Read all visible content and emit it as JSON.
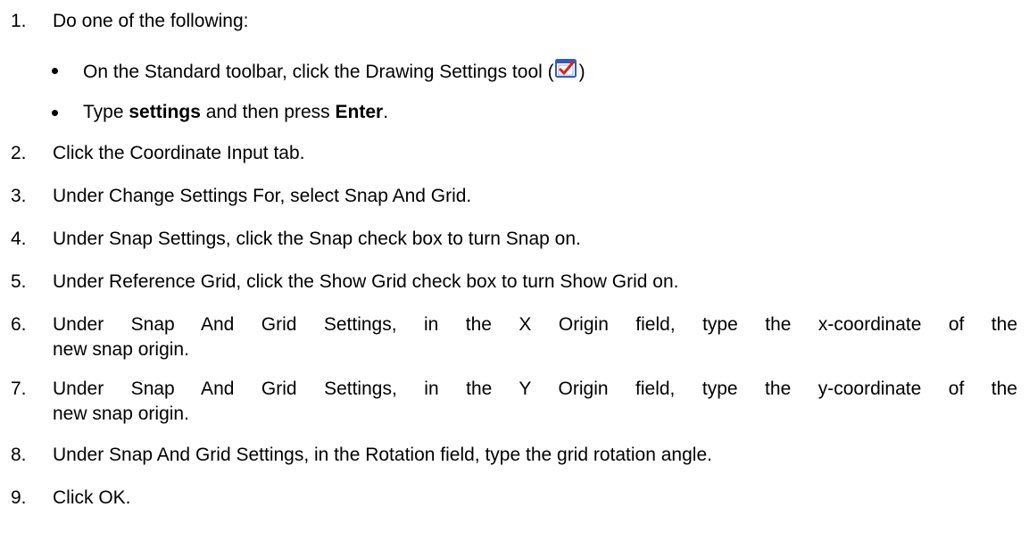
{
  "steps": [
    {
      "num": "1.",
      "text": "Do one of the following:"
    },
    {
      "num": "2.",
      "text": "Click the Coordinate Input tab."
    },
    {
      "num": "3.",
      "text": "Under Change Settings For, select Snap And Grid."
    },
    {
      "num": "4.",
      "text": "Under Snap Settings, click the Snap check box to turn Snap on."
    },
    {
      "num": "5.",
      "text": "Under Reference Grid, click the Show Grid check box to turn Show Grid on."
    },
    {
      "num": "6.",
      "line1": "Under Snap And Grid Settings, in the X Origin field, type the x-coordinate of the",
      "line2": "new snap origin."
    },
    {
      "num": "7.",
      "line1": "Under Snap And Grid Settings, in the Y Origin field, type the y-coordinate of the",
      "line2": "new snap origin."
    },
    {
      "num": "8.",
      "text": "Under Snap And Grid Settings, in the Rotation field, type the grid rotation angle."
    },
    {
      "num": "9.",
      "text": "Click OK."
    }
  ],
  "bullets": {
    "toolbar_before": "On the Standard toolbar, click the Drawing Settings tool (",
    "toolbar_after": ")",
    "type_prefix": "Type ",
    "type_bold_1": "settings",
    "type_middle": " and then press ",
    "type_bold_2": "Enter",
    "type_suffix": "."
  },
  "icons": {
    "drawing_settings": "drawing-settings-checkmark-icon"
  },
  "colors": {
    "icon_check": "#e0201b",
    "icon_frame": "#2f5fb7"
  }
}
